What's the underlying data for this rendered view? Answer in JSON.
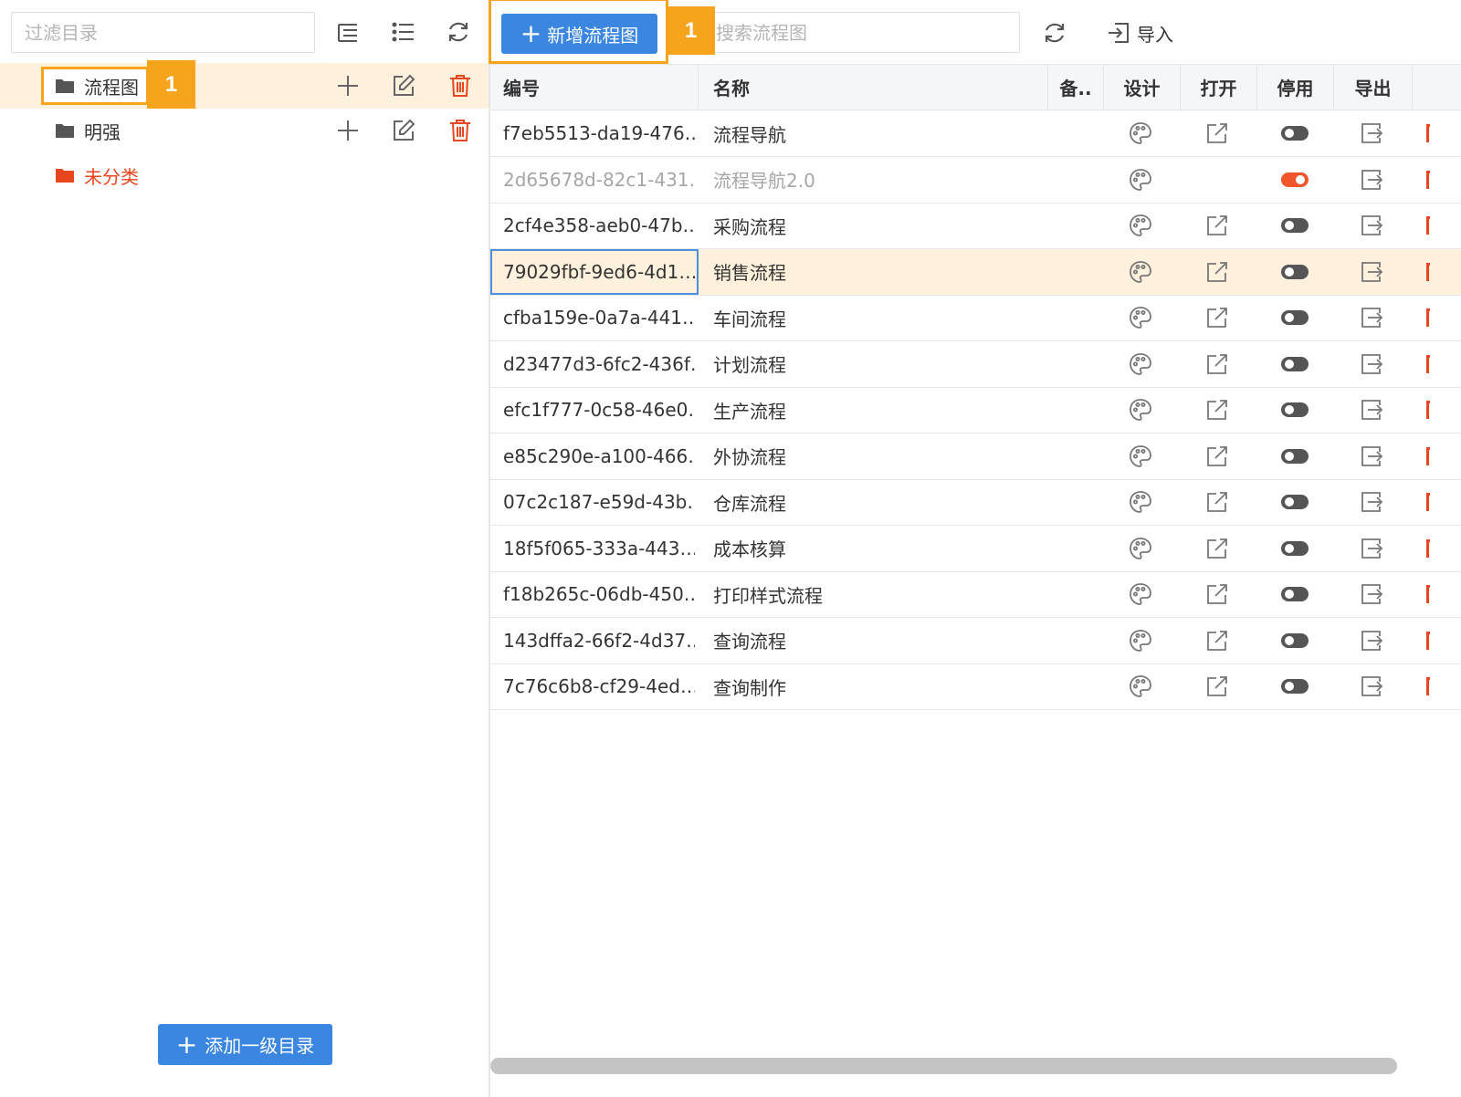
{
  "sidebar": {
    "filter_placeholder": "过滤目录",
    "toolbar_icons": [
      "list-tree-icon",
      "list-icon",
      "refresh-icon"
    ],
    "tree": [
      {
        "label": "流程图",
        "selected": true,
        "highlighted": true,
        "badge": "1"
      },
      {
        "label": "明强",
        "selected": false
      },
      {
        "label": "未分类",
        "selected": false,
        "color": "#e8461e"
      }
    ],
    "add_root_label": "添加一级目录"
  },
  "toolbar": {
    "new_label": "新增流程图",
    "new_badge": "1",
    "search_placeholder": "搜索流程图",
    "import_label": "导入"
  },
  "table": {
    "headers": {
      "id": "编号",
      "name": "名称",
      "remark": "备..",
      "design": "设计",
      "open": "打开",
      "disable": "停用",
      "export": "导出"
    },
    "rows": [
      {
        "id": "f7eb5513-da19-476…",
        "name": "流程导航",
        "disabled": false,
        "open": true
      },
      {
        "id": "2d65678d-82c1-431…",
        "name": "流程导航2.0",
        "disabled": true,
        "open": false
      },
      {
        "id": "2cf4e358-aeb0-47b…",
        "name": "采购流程",
        "disabled": false,
        "open": true
      },
      {
        "id": "79029fbf-9ed6-4d1…",
        "name": "销售流程",
        "disabled": false,
        "open": true,
        "highlighted": true
      },
      {
        "id": "cfba159e-0a7a-441…",
        "name": "车间流程",
        "disabled": false,
        "open": true
      },
      {
        "id": "d23477d3-6fc2-436f…",
        "name": "计划流程",
        "disabled": false,
        "open": true
      },
      {
        "id": "efc1f777-0c58-46e0…",
        "name": "生产流程",
        "disabled": false,
        "open": true
      },
      {
        "id": "e85c290e-a100-466…",
        "name": "外协流程",
        "disabled": false,
        "open": true
      },
      {
        "id": "07c2c187-e59d-43b…",
        "name": "仓库流程",
        "disabled": false,
        "open": true
      },
      {
        "id": "18f5f065-333a-443…",
        "name": "成本核算",
        "disabled": false,
        "open": true
      },
      {
        "id": "f18b265c-06db-450…",
        "name": "打印样式流程",
        "disabled": false,
        "open": true
      },
      {
        "id": "143dffa2-66f2-4d37…",
        "name": "查询流程",
        "disabled": false,
        "open": true
      },
      {
        "id": "7c76c6b8-cf29-4ed…",
        "name": "查询制作",
        "disabled": false,
        "open": true
      }
    ]
  },
  "colors": {
    "primary": "#3a86e0",
    "highlight_border": "#f7a41d",
    "selected_row": "#fff1dc",
    "danger": "#e8461e",
    "toggle_on": "#f0552b"
  }
}
